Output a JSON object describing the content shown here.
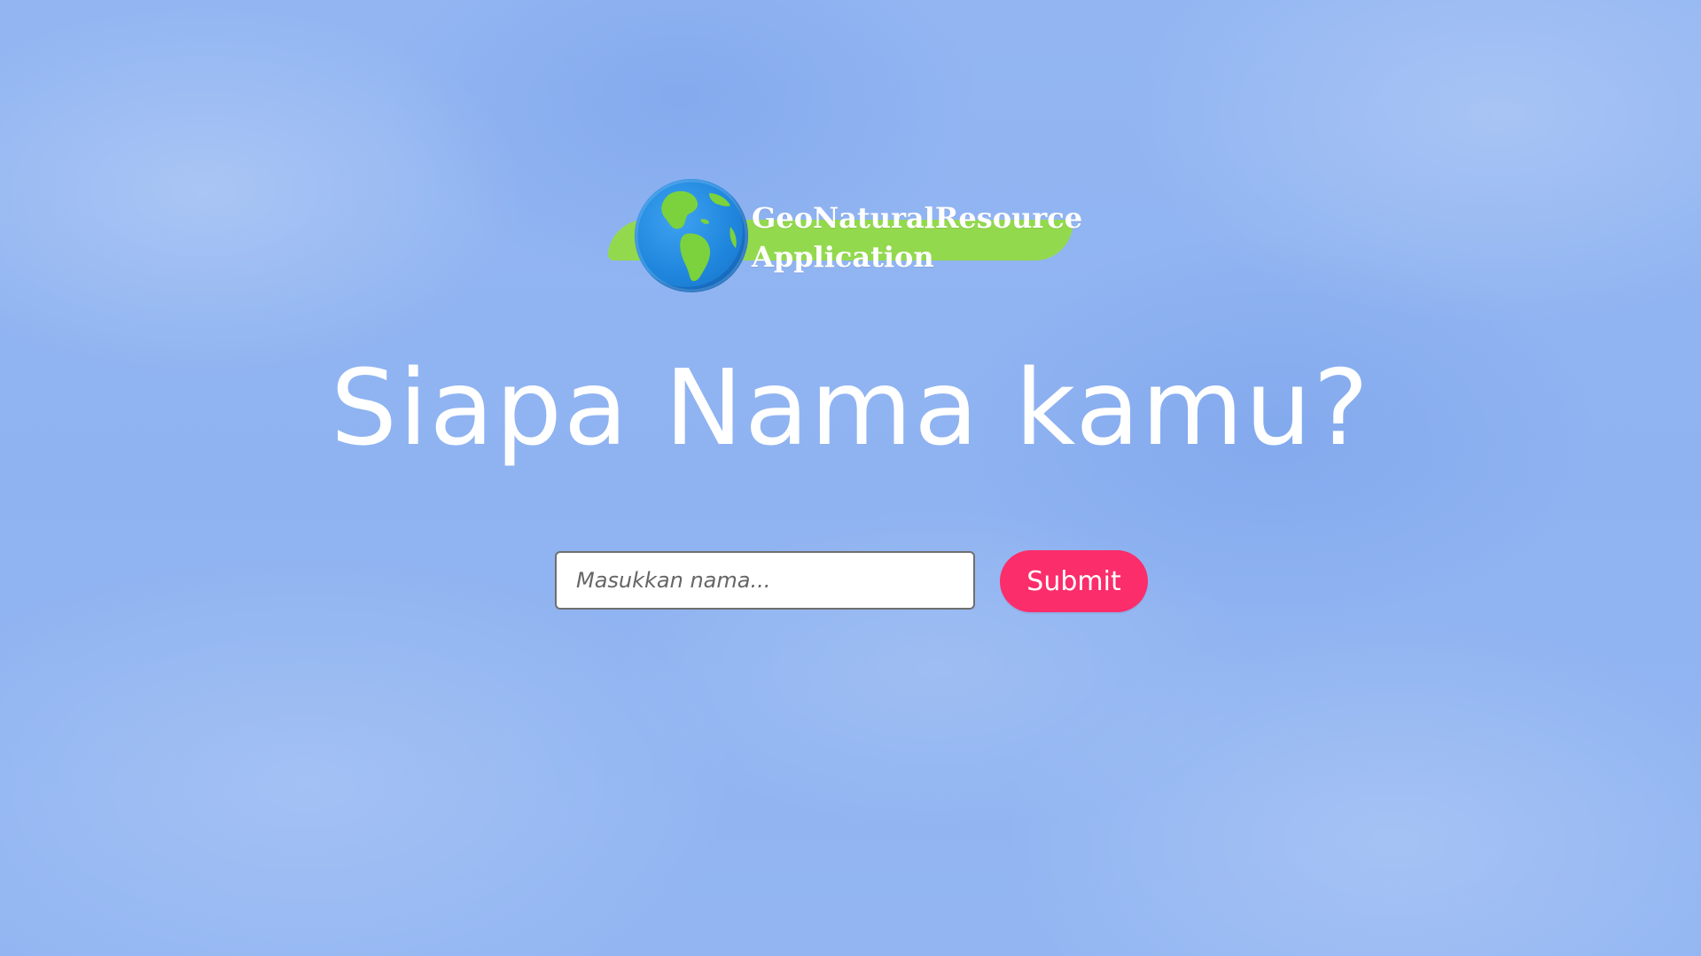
{
  "logo": {
    "line1": "GeoNaturalResource",
    "line2": "Application",
    "icon": "globe-icon",
    "band_color": "#93d94e"
  },
  "headline": "Siapa Nama kamu?",
  "form": {
    "name_placeholder": "Masukkan nama...",
    "name_value": "",
    "submit_label": "Submit"
  },
  "colors": {
    "background": "#8fb3f1",
    "submit": "#fb2d6b",
    "text": "#ffffff"
  }
}
